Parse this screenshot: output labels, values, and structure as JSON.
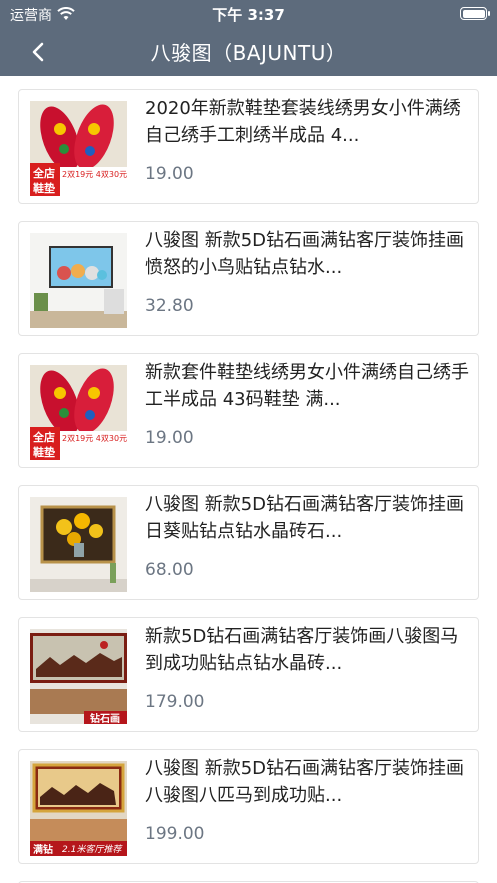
{
  "status_bar": {
    "carrier": "运营商",
    "time": "下午 3:37",
    "wifi_icon": "wifi-icon",
    "battery_icon": "battery-icon"
  },
  "nav": {
    "title": "八骏图（BAJUNTU）",
    "back_icon": "chevron-left-icon"
  },
  "products": [
    {
      "title": "2020年新款鞋垫套装线绣男女小件满绣自己绣手工刺绣半成品 4...",
      "price": "19.00",
      "thumb": "insoles"
    },
    {
      "title": "八骏图 新款5D钻石画满钻客厅装饰挂画愤怒的小鸟贴钻点钻水...",
      "price": "32.80",
      "thumb": "birds"
    },
    {
      "title": "新款套件鞋垫线绣男女小件满绣自己绣手工半成品 43码鞋垫 满...",
      "price": "19.00",
      "thumb": "insoles"
    },
    {
      "title": "八骏图 新款5D钻石画满钻客厅装饰挂画日葵贴钻点钻水晶砖石...",
      "price": "68.00",
      "thumb": "sunflower"
    },
    {
      "title": "新款5D钻石画满钻客厅装饰画八骏图马到成功贴钻点钻水晶砖...",
      "price": "179.00",
      "thumb": "horses"
    },
    {
      "title": "八骏图 新款5D钻石画满钻客厅装饰挂画八骏图八匹马到成功贴...",
      "price": "199.00",
      "thumb": "horses2"
    }
  ],
  "insole_labels": {
    "shop": "全店",
    "item": "鞋垫",
    "promo": "2双19元 4双30元"
  },
  "horse_labels": {
    "tag1": "钻石画",
    "tag2": "满钻",
    "tag3": "2.1米客厅推荐"
  },
  "colors": {
    "navbar": "#5d6b7c",
    "price": "#6c7683",
    "border": "#e3e3e3"
  }
}
